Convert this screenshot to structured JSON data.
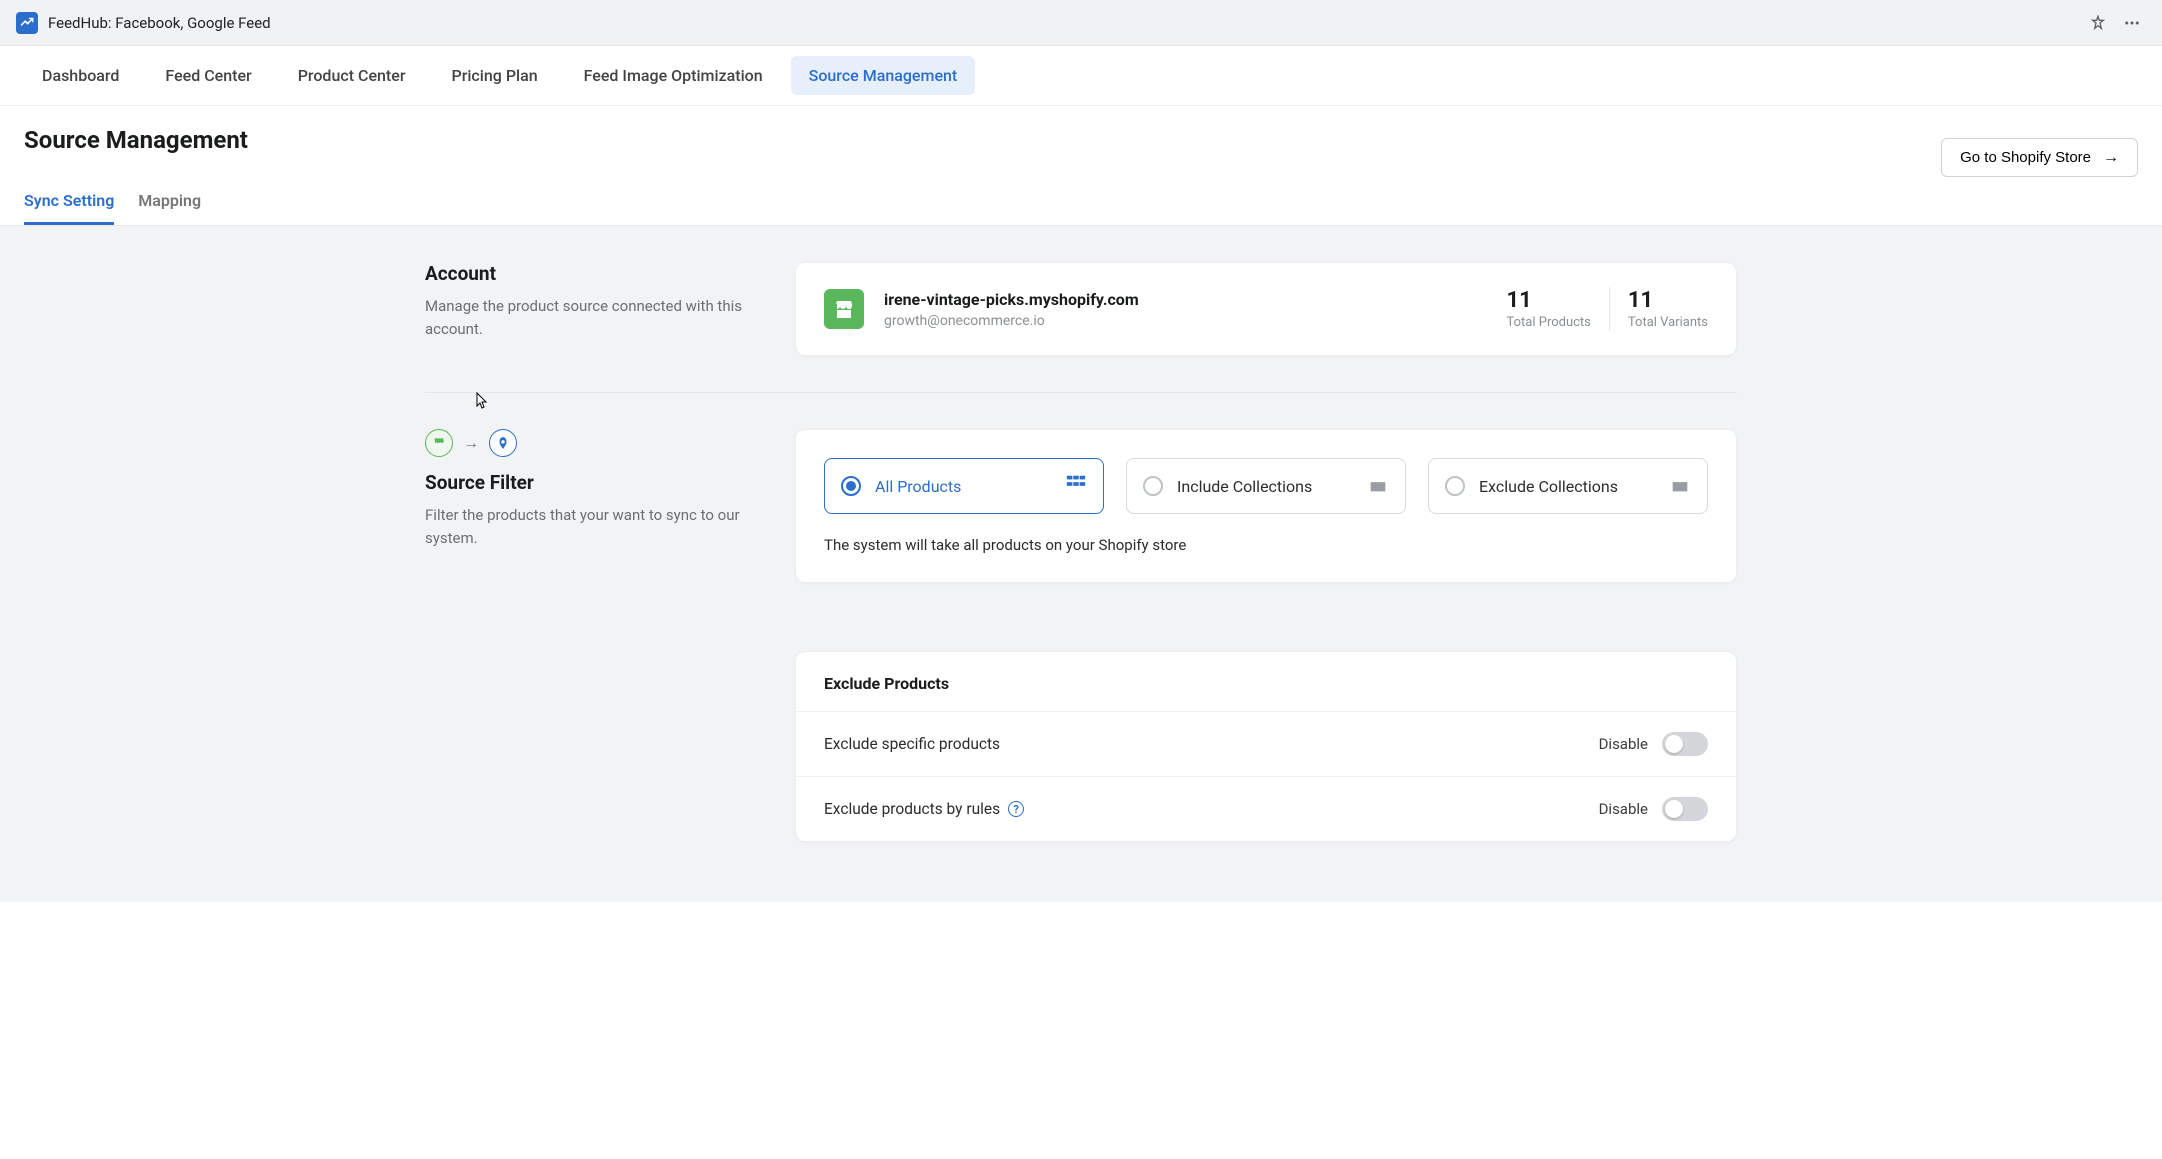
{
  "appbar": {
    "title": "FeedHub: Facebook, Google Feed"
  },
  "nav": {
    "items": [
      {
        "label": "Dashboard",
        "active": false
      },
      {
        "label": "Feed Center",
        "active": false
      },
      {
        "label": "Product Center",
        "active": false
      },
      {
        "label": "Pricing Plan",
        "active": false
      },
      {
        "label": "Feed Image Optimization",
        "active": false
      },
      {
        "label": "Source Management",
        "active": true
      }
    ]
  },
  "page": {
    "title": "Source Management",
    "goto_button": "Go to Shopify Store"
  },
  "subtabs": [
    {
      "label": "Sync Setting",
      "active": true
    },
    {
      "label": "Mapping",
      "active": false
    }
  ],
  "account_section": {
    "heading": "Account",
    "description": "Manage the product source connected with this account.",
    "domain": "irene-vintage-picks.myshopify.com",
    "email": "growth@onecommerce.io",
    "total_products_value": "11",
    "total_products_label": "Total Products",
    "total_variants_value": "11",
    "total_variants_label": "Total Variants"
  },
  "source_filter": {
    "heading": "Source Filter",
    "description": "Filter the products that your want to sync to our system.",
    "options": [
      {
        "label": "All Products",
        "selected": true
      },
      {
        "label": "Include Collections",
        "selected": false
      },
      {
        "label": "Exclude Collections",
        "selected": false
      }
    ],
    "selected_description": "The system will take all products on your Shopify store"
  },
  "exclude_section": {
    "heading": "Exclude Products",
    "rows": [
      {
        "label": "Exclude specific products",
        "has_help": false,
        "state": "Disable"
      },
      {
        "label": "Exclude products by rules",
        "has_help": true,
        "state": "Disable"
      }
    ]
  }
}
